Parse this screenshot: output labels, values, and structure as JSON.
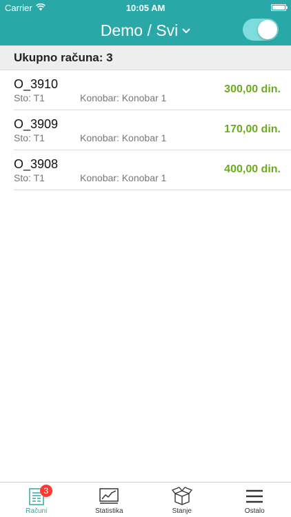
{
  "status_bar": {
    "carrier": "Carrier",
    "time": "10:05 AM",
    "wifi_icon": "wifi-icon",
    "battery_icon": "battery-icon",
    "battery_level": 1.0
  },
  "header": {
    "title": "Demo / Svi",
    "dropdown_icon": "chevron-down-icon",
    "toggle_on": true
  },
  "summary": {
    "label": "Ukupno računa: 3"
  },
  "receipts": [
    {
      "id": "O_3910",
      "table": "Sto: T1",
      "waiter": "Konobar: Konobar 1",
      "amount": "300,00 din."
    },
    {
      "id": "O_3909",
      "table": "Sto: T1",
      "waiter": "Konobar: Konobar 1",
      "amount": "170,00 din."
    },
    {
      "id": "O_3908",
      "table": "Sto: T1",
      "waiter": "Konobar: Konobar 1",
      "amount": "400,00 din."
    }
  ],
  "tabbar": {
    "tabs": [
      {
        "label": "Računi",
        "icon": "receipt-icon",
        "badge": "3",
        "active": true
      },
      {
        "label": "Statistika",
        "icon": "chart-icon",
        "active": false
      },
      {
        "label": "Stanje",
        "icon": "box-icon",
        "active": false
      },
      {
        "label": "Ostalo",
        "icon": "menu-icon",
        "active": false
      }
    ]
  },
  "colors": {
    "accent": "#2aa8a8",
    "amount": "#6aab1c",
    "badge": "#ff3b30"
  }
}
